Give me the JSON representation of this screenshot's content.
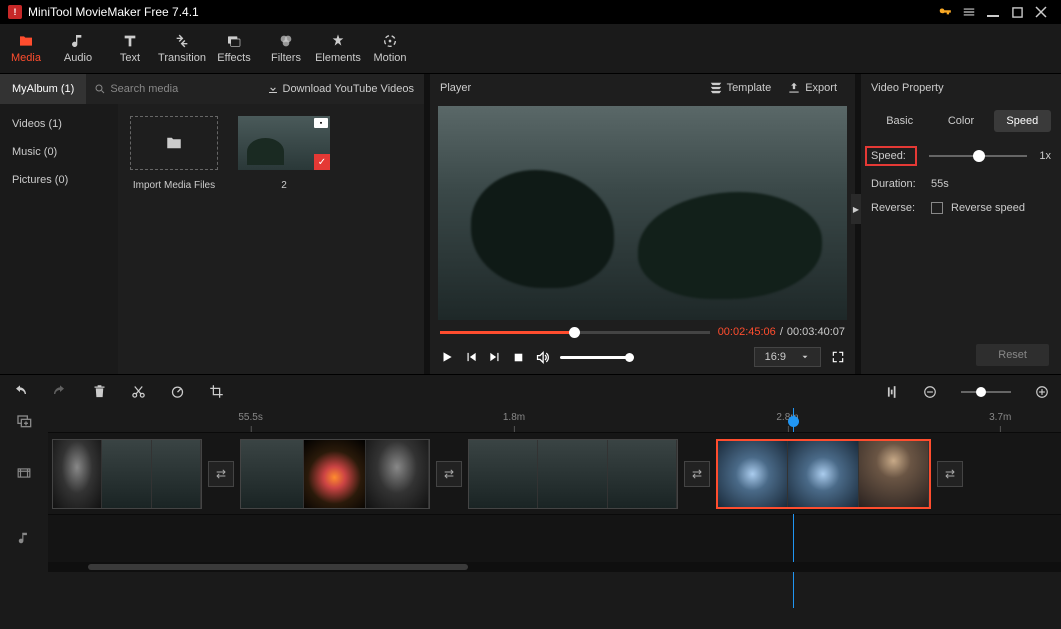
{
  "app": {
    "title": "MiniTool MovieMaker Free 7.4.1"
  },
  "tabs": {
    "media": "Media",
    "audio": "Audio",
    "text": "Text",
    "transition": "Transition",
    "effects": "Effects",
    "filters": "Filters",
    "elements": "Elements",
    "motion": "Motion"
  },
  "media": {
    "album": "MyAlbum (1)",
    "search_placeholder": "Search media",
    "download": "Download YouTube Videos",
    "side": {
      "videos": "Videos (1)",
      "music": "Music (0)",
      "pictures": "Pictures (0)"
    },
    "import_label": "Import Media Files",
    "clip_label": "2"
  },
  "player": {
    "title": "Player",
    "template": "Template",
    "export": "Export",
    "time_current": "00:02:45:06",
    "time_sep": " / ",
    "time_total": "00:03:40:07",
    "aspect": "16:9"
  },
  "prop": {
    "title": "Video Property",
    "tab_basic": "Basic",
    "tab_color": "Color",
    "tab_speed": "Speed",
    "speed_label": "Speed:",
    "speed_value": "1x",
    "duration_label": "Duration:",
    "duration_value": "55s",
    "reverse_label": "Reverse:",
    "reverse_check": "Reverse speed",
    "reset": "Reset"
  },
  "timeline": {
    "marks": [
      "55.5s",
      "1.8m",
      "2.8m",
      "3.7m"
    ]
  }
}
